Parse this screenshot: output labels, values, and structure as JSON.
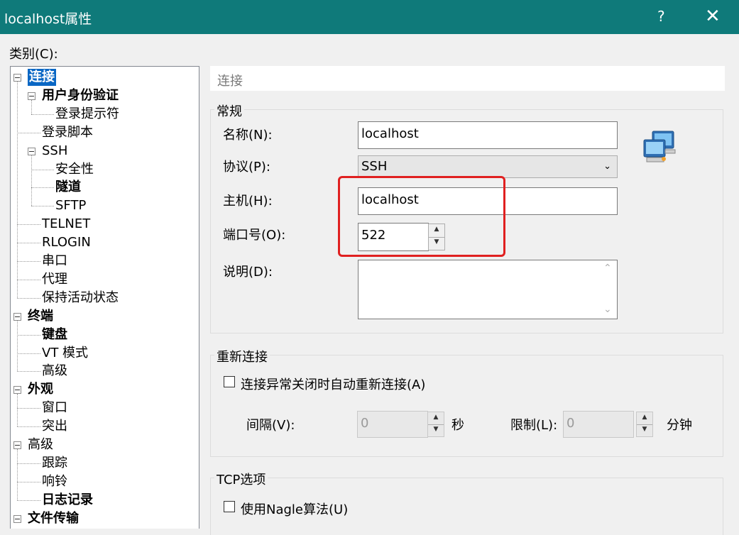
{
  "window": {
    "title": "localhost属性",
    "help": "?",
    "close": "✕"
  },
  "category_label": "类别(C):",
  "tree": [
    {
      "label": "连接",
      "level": 0,
      "bold": true,
      "selected": true,
      "expander": true
    },
    {
      "label": "用户身份验证",
      "level": 1,
      "bold": true,
      "expander": true
    },
    {
      "label": "登录提示符",
      "level": 2
    },
    {
      "label": "登录脚本",
      "level": 1
    },
    {
      "label": "SSH",
      "level": 1,
      "expander": true
    },
    {
      "label": "安全性",
      "level": 2
    },
    {
      "label": "隧道",
      "level": 2,
      "bold": true
    },
    {
      "label": "SFTP",
      "level": 2
    },
    {
      "label": "TELNET",
      "level": 1
    },
    {
      "label": "RLOGIN",
      "level": 1
    },
    {
      "label": "串口",
      "level": 1
    },
    {
      "label": "代理",
      "level": 1
    },
    {
      "label": "保持活动状态",
      "level": 1
    },
    {
      "label": "终端",
      "level": 0,
      "bold": true,
      "expander": true
    },
    {
      "label": "键盘",
      "level": 1,
      "bold": true
    },
    {
      "label": "VT 模式",
      "level": 1
    },
    {
      "label": "高级",
      "level": 1
    },
    {
      "label": "外观",
      "level": 0,
      "bold": true,
      "expander": true
    },
    {
      "label": "窗口",
      "level": 1
    },
    {
      "label": "突出",
      "level": 1
    },
    {
      "label": "高级",
      "level": 0,
      "expander": true
    },
    {
      "label": "跟踪",
      "level": 1
    },
    {
      "label": "响铃",
      "level": 1
    },
    {
      "label": "日志记录",
      "level": 1,
      "bold": true
    },
    {
      "label": "文件传输",
      "level": 0,
      "bold": true,
      "expander": true
    }
  ],
  "section_title": "连接",
  "general": {
    "group_label": "常规",
    "name_label": "名称(N):",
    "name_value": "localhost",
    "protocol_label": "协议(P):",
    "protocol_value": "SSH",
    "host_label": "主机(H):",
    "host_value": "localhost",
    "port_label": "端口号(O):",
    "port_value": "522",
    "desc_label": "说明(D):",
    "desc_value": ""
  },
  "reconnect": {
    "group_label": "重新连接",
    "checkbox_label": "连接异常关闭时自动重新连接(A)",
    "interval_label": "间隔(V):",
    "interval_value": "0",
    "interval_unit": "秒",
    "limit_label": "限制(L):",
    "limit_value": "0",
    "limit_unit": "分钟"
  },
  "tcp": {
    "group_label": "TCP选项",
    "nagle_label": "使用Nagle算法(U)"
  },
  "colors": {
    "titlebar": "#0f7a7a",
    "selection": "#0a67c4",
    "highlight": "#e02020"
  }
}
